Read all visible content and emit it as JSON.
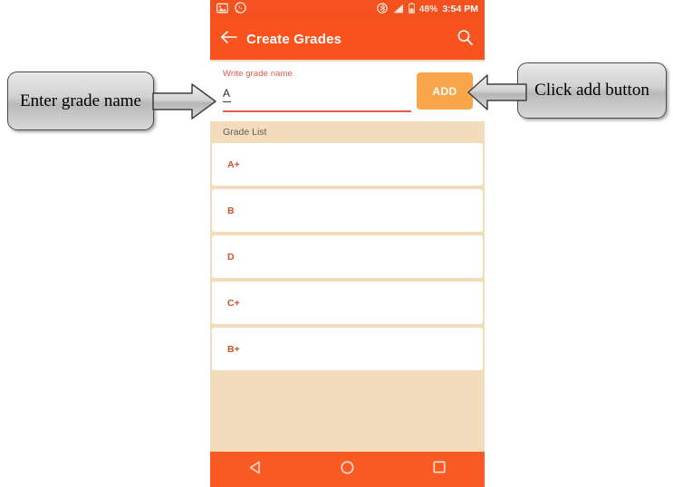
{
  "statusbar": {
    "left_icons": [
      {
        "name": "image-icon",
        "glyph": "image"
      },
      {
        "name": "whatsapp-icon",
        "glyph": "whatsapp"
      }
    ],
    "right_icons": [
      {
        "name": "bluetooth-icon",
        "glyph": "bluetooth"
      },
      {
        "name": "signal-icon",
        "glyph": "signal"
      },
      {
        "name": "battery-icon",
        "glyph": "battery"
      }
    ],
    "battery_percent": "48%",
    "time": "3:54 PM"
  },
  "appbar": {
    "back_icon": "arrow-left-icon",
    "title": "Create Grades",
    "search_icon": "search-icon"
  },
  "form": {
    "field_label": "Write grade name",
    "field_value": "A",
    "field_placeholder": "Write grade name",
    "add_label": "ADD"
  },
  "list": {
    "header": "Grade List",
    "items": [
      {
        "label": "A+"
      },
      {
        "label": "B"
      },
      {
        "label": "D"
      },
      {
        "label": "C+"
      },
      {
        "label": "B+"
      }
    ]
  },
  "navbar": {
    "back": "back-triangle-icon",
    "home": "home-circle-icon",
    "recents": "recents-square-icon"
  },
  "annotations": {
    "left": "Enter grade name",
    "right": "Click add button"
  },
  "colors": {
    "appbar_orange": "#f9541f",
    "statusbar_orange": "#f4511e",
    "navbar_orange": "#fa5a23",
    "background_tan": "#f3dcbc",
    "add_button_orange": "#f9a64b",
    "label_red": "#e0594a",
    "grade_text": "#d1502a",
    "card_white": "#ffffff"
  }
}
